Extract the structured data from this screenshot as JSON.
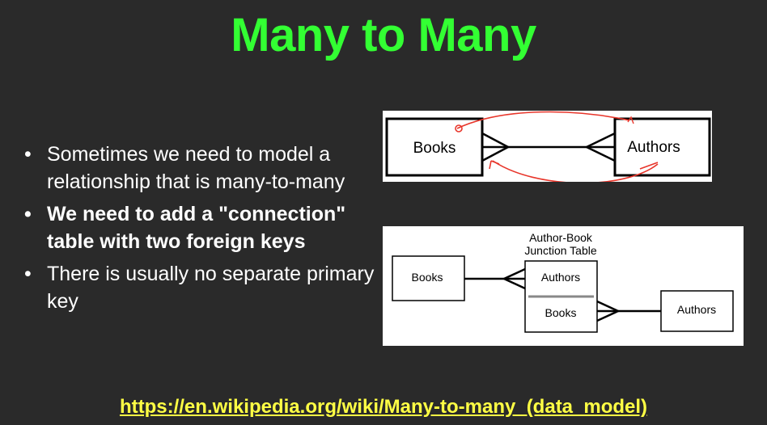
{
  "slide": {
    "title": "Many to Many",
    "bullets": [
      {
        "text": "Sometimes we need to model a relationship that is many-to-many",
        "bold": false
      },
      {
        "text": "We need to add a \"connection\" table with two foreign keys",
        "bold": true
      },
      {
        "text": "There is usually no separate primary key",
        "bold": false
      }
    ],
    "bullet_glyph": "•",
    "diagram_top": {
      "left_entity": "Books",
      "right_entity": "Authors",
      "annotation_color": "#e8352a"
    },
    "diagram_bottom": {
      "junction_caption_line1": "Author-Book",
      "junction_caption_line2": "Junction Table",
      "left_entity": "Books",
      "junction_top": "Authors",
      "junction_bottom": "Books",
      "right_entity": "Authors"
    },
    "link": "https://en.wikipedia.org/wiki/Many-to-many_(data_model)",
    "colors": {
      "title": "#33ff33",
      "link": "#ffff44",
      "background": "#2a2a2a"
    }
  }
}
